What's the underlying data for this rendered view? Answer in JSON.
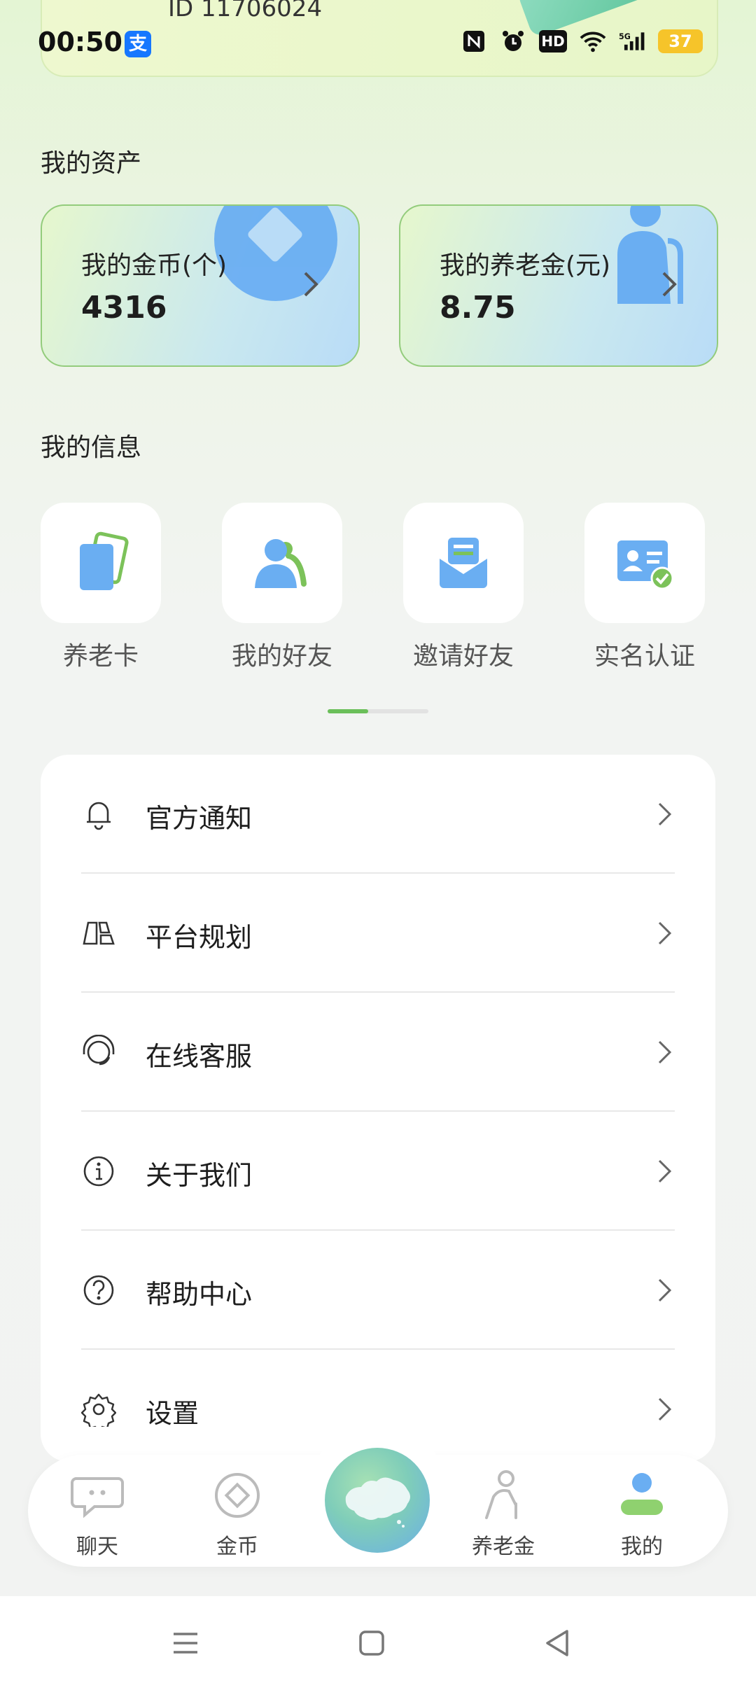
{
  "status_bar": {
    "time": "00:50",
    "battery": "37",
    "hd": "HD",
    "network": "5G"
  },
  "top_card": {
    "id_text": "ID 11706024"
  },
  "assets": {
    "title": "我的资产",
    "coins": {
      "label": "我的金币(个)",
      "value": "4316"
    },
    "pension": {
      "label": "我的养老金(元)",
      "value": "8.75"
    }
  },
  "info": {
    "title": "我的信息",
    "items": [
      {
        "label": "养老卡",
        "icon": "pension-card-icon"
      },
      {
        "label": "我的好友",
        "icon": "friends-icon"
      },
      {
        "label": "邀请好友",
        "icon": "invite-mail-icon"
      },
      {
        "label": "实名认证",
        "icon": "id-verify-icon"
      }
    ],
    "page_indicator": 0.4
  },
  "menu": [
    {
      "label": "官方通知",
      "icon": "bell-icon"
    },
    {
      "label": "平台规划",
      "icon": "plan-icon"
    },
    {
      "label": "在线客服",
      "icon": "headset-icon"
    },
    {
      "label": "关于我们",
      "icon": "info-icon"
    },
    {
      "label": "帮助中心",
      "icon": "help-icon"
    },
    {
      "label": "设置",
      "icon": "gear-icon"
    }
  ],
  "tabbar": {
    "items": [
      {
        "label": "聊天",
        "icon": "chat-icon"
      },
      {
        "label": "金币",
        "icon": "coin-icon"
      },
      {
        "label": "",
        "icon": "china-map-icon"
      },
      {
        "label": "养老金",
        "icon": "elder-icon"
      },
      {
        "label": "我的",
        "icon": "profile-icon"
      }
    ],
    "active": "我的"
  },
  "colors": {
    "accent_green": "#6bbf5a",
    "accent_blue": "#6aaef2",
    "card_border": "#93cc7c"
  }
}
